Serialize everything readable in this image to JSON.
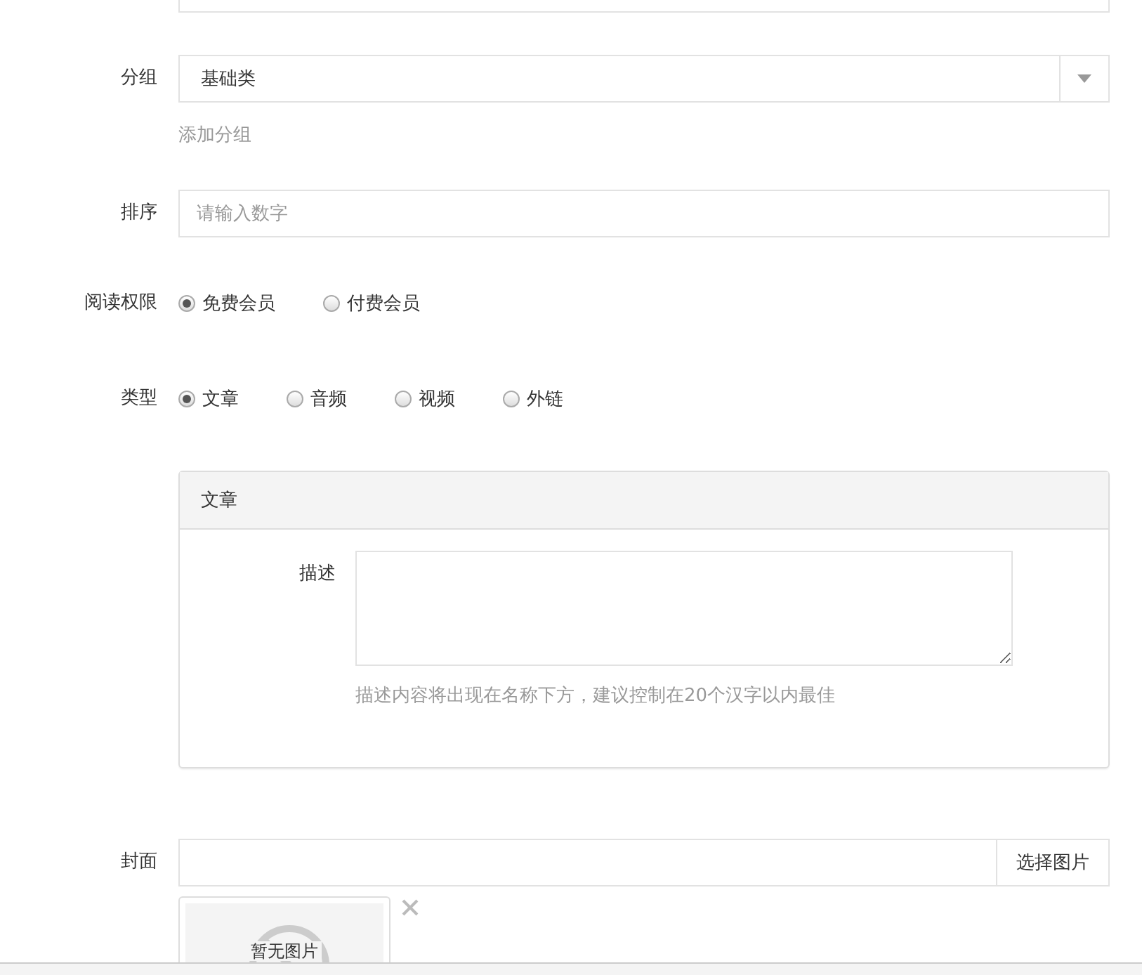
{
  "group": {
    "label": "分组",
    "value": "基础类",
    "link": "添加分组"
  },
  "sort": {
    "label": "排序",
    "placeholder": "请输入数字"
  },
  "access": {
    "label": "阅读权限",
    "options": [
      {
        "label": "免费会员",
        "selected": true
      },
      {
        "label": "付费会员",
        "selected": false
      }
    ]
  },
  "type": {
    "label": "类型",
    "options": [
      {
        "label": "文章",
        "selected": true
      },
      {
        "label": "音频",
        "selected": false
      },
      {
        "label": "视频",
        "selected": false
      },
      {
        "label": "外链",
        "selected": false
      }
    ]
  },
  "panel": {
    "title": "文章",
    "field_label": "描述",
    "help": "描述内容将出现在名称下方，建议控制在20个汉字以内最佳"
  },
  "cover": {
    "label": "封面",
    "button": "选择图片",
    "thumbnail_text": "暂无图片"
  }
}
